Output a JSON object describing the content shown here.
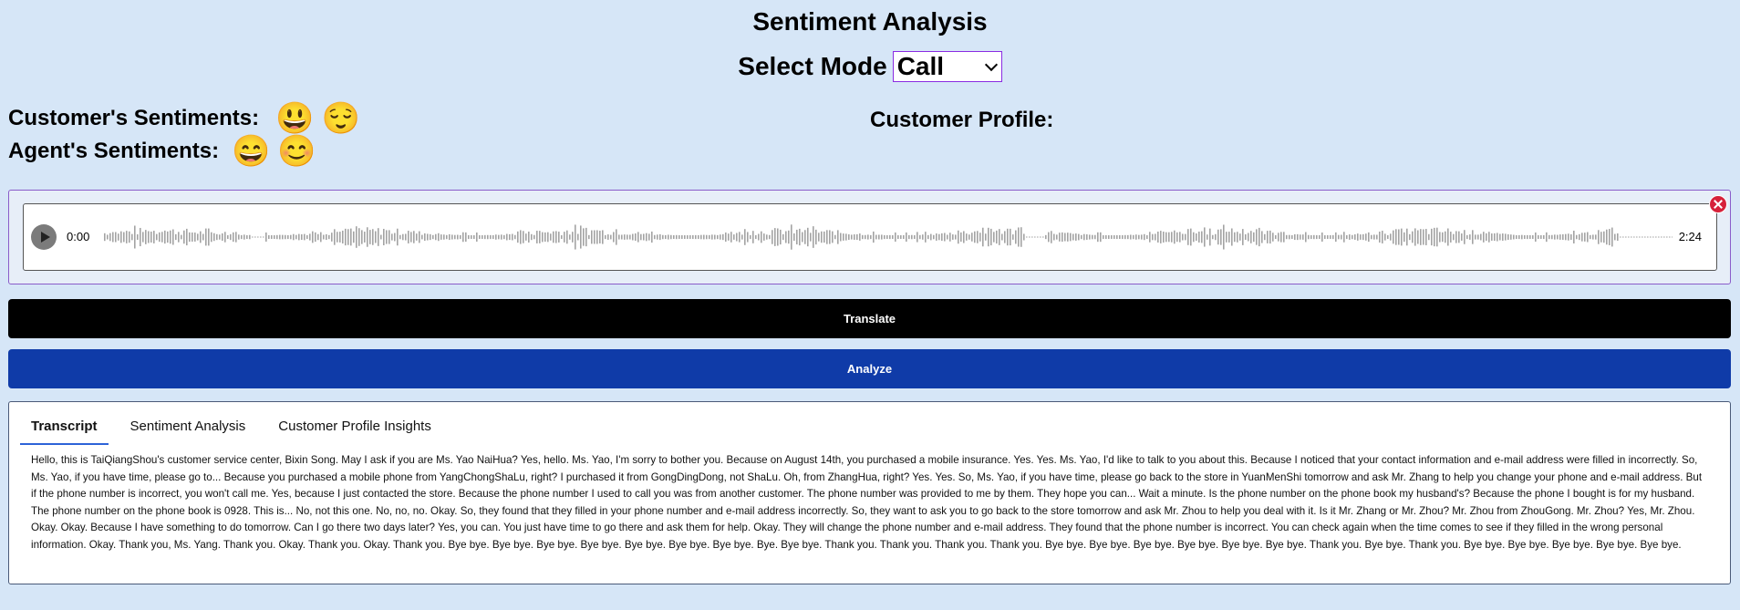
{
  "title": "Sentiment Analysis",
  "mode": {
    "label": "Select Mode",
    "selected": "Call"
  },
  "customer_sentiments": {
    "label": "Customer's Sentiments:",
    "emojis": [
      "😃",
      "😌"
    ]
  },
  "agent_sentiments": {
    "label": "Agent's Sentiments:",
    "emojis": [
      "😄",
      "😊"
    ]
  },
  "profile": {
    "label": "Customer Profile:"
  },
  "player": {
    "time_current": "0:00",
    "time_total": "2:24"
  },
  "buttons": {
    "translate": "Translate",
    "analyze": "Analyze"
  },
  "tabs": [
    {
      "label": "Transcript",
      "active": true
    },
    {
      "label": "Sentiment Analysis",
      "active": false
    },
    {
      "label": "Customer Profile Insights",
      "active": false
    }
  ],
  "transcript": "Hello, this is TaiQiangShou's customer service center, Bixin Song. May I ask if you are Ms. Yao NaiHua? Yes, hello. Ms. Yao, I'm sorry to bother you. Because on August 14th, you purchased a mobile insurance. Yes. Yes. Ms. Yao, I'd like to talk to you about this. Because I noticed that your contact information and e-mail address were filled in incorrectly. So, Ms. Yao, if you have time, please go to... Because you purchased a mobile phone from YangChongShaLu, right? I purchased it from GongDingDong, not ShaLu. Oh, from ZhangHua, right? Yes. Yes. So, Ms. Yao, if you have time, please go back to the store in YuanMenShi tomorrow and ask Mr. Zhang to help you change your phone and e-mail address. But if the phone number is incorrect, you won't call me. Yes, because I just contacted the store. Because the phone number I used to call you was from another customer. The phone number was provided to me by them. They hope you can... Wait a minute. Is the phone number on the phone book my husband's? Because the phone I bought is for my husband. The phone number on the phone book is 0928. This is... No, not this one. No, no, no. Okay. So, they found that they filled in your phone number and e-mail address incorrectly. So, they want to ask you to go back to the store tomorrow and ask Mr. Zhou to help you deal with it. Is it Mr. Zhang or Mr. Zhou? Mr. Zhou from ZhouGong. Mr. Zhou? Yes, Mr. Zhou. Okay. Okay. Because I have something to do tomorrow. Can I go there two days later? Yes, you can. You just have time to go there and ask them for help. Okay. They will change the phone number and e-mail address. They found that the phone number is incorrect. You can check again when the time comes to see if they filled in the wrong personal information. Okay. Thank you, Ms. Yang. Thank you. Okay. Thank you. Okay. Thank you. Bye bye. Bye bye. Bye bye. Bye bye. Bye bye. Bye bye. Bye bye. Bye. Bye bye. Thank you. Thank you. Thank you. Thank you. Bye bye. Bye bye. Bye bye. Bye bye. Bye bye. Bye bye. Thank you. Bye bye. Thank you. Bye bye. Bye bye. Bye bye. Bye bye. Bye bye.",
  "colors": {
    "background": "#d6e6f7",
    "analyze_button": "#0f3ba8",
    "translate_button": "#000000",
    "tab_underline": "#2d63d8",
    "close_icon": "#d6213a"
  }
}
